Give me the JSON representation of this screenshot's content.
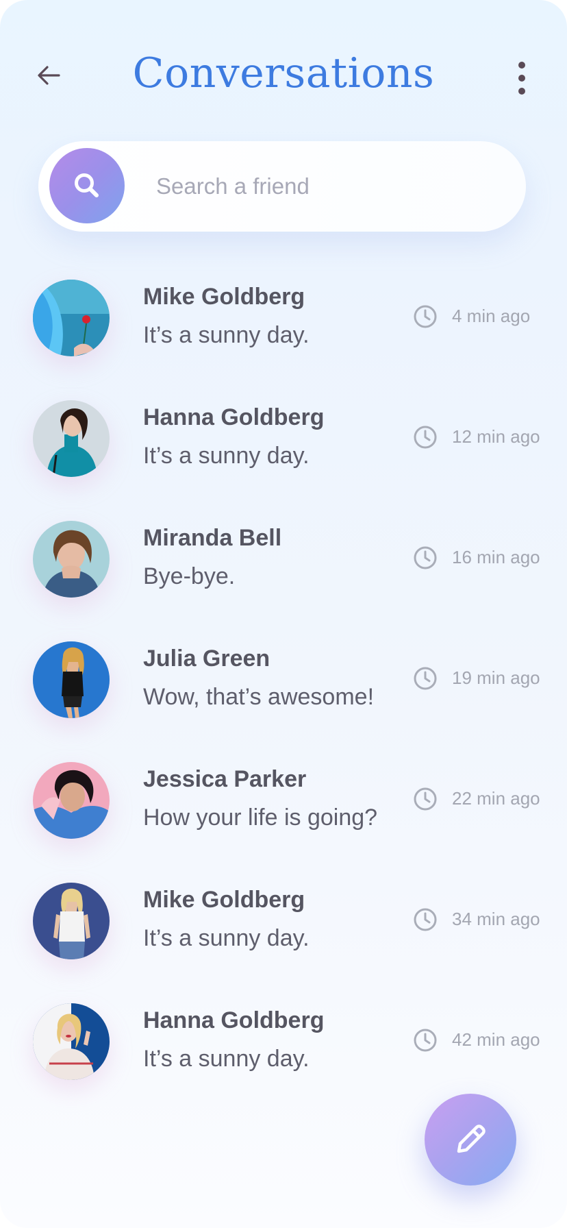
{
  "header": {
    "title": "Conversations",
    "back_icon": "arrow-left-icon",
    "menu_icon": "more-vertical-icon"
  },
  "search": {
    "placeholder": "Search a friend",
    "icon": "search-icon"
  },
  "conversations": [
    {
      "name": "Mike Goldberg",
      "message": "It’s a sunny day.",
      "time": "4 min ago"
    },
    {
      "name": "Hanna Goldberg",
      "message": "It’s a sunny day.",
      "time": "12 min ago"
    },
    {
      "name": "Miranda Bell",
      "message": "Bye-bye.",
      "time": "16 min ago"
    },
    {
      "name": "Julia Green",
      "message": "Wow, that’s awesome!",
      "time": "19 min ago"
    },
    {
      "name": "Jessica Parker",
      "message": "How your life is going?",
      "time": "22 min ago"
    },
    {
      "name": "Mike Goldberg",
      "message": "It’s a sunny day.",
      "time": "34 min ago"
    },
    {
      "name": "Hanna Goldberg",
      "message": "It’s a sunny day.",
      "time": "42 min ago"
    }
  ],
  "fab": {
    "icon": "pencil-icon"
  },
  "colors": {
    "title": "#3d7be0",
    "accent_gradient_start": "#b58be8",
    "accent_gradient_end": "#7ea3ee",
    "name_text": "#555561",
    "message_text": "#5e5e6c",
    "time_text": "#a3a6b1"
  }
}
